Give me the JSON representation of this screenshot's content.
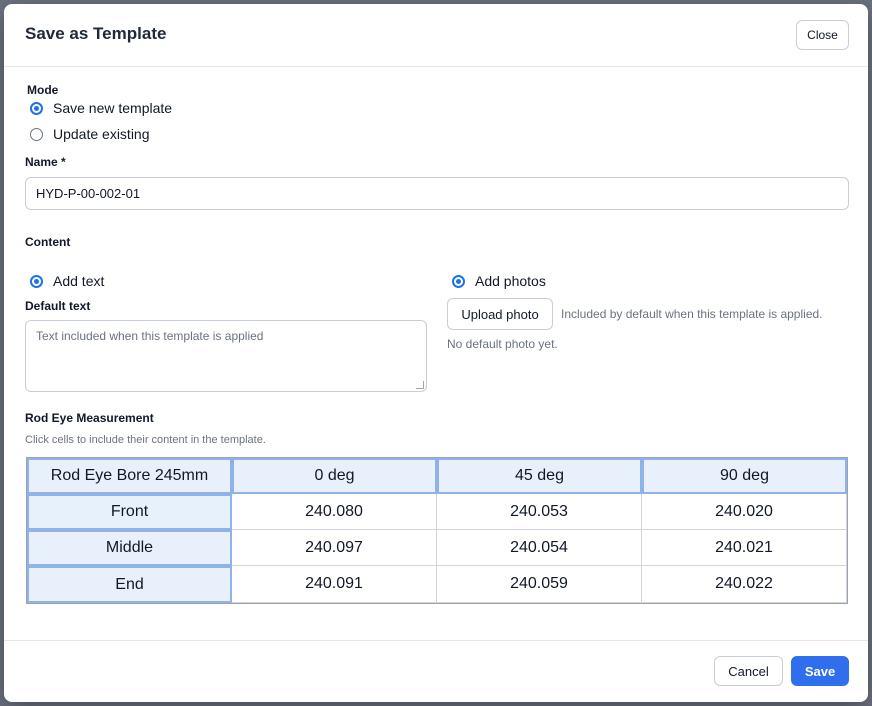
{
  "dialog": {
    "title": "Save as Template",
    "close_label": "Close"
  },
  "mode": {
    "label": "Mode",
    "options": [
      {
        "label": "Save new template",
        "selected": true
      },
      {
        "label": "Update existing",
        "selected": false
      }
    ]
  },
  "name": {
    "label": "Name *",
    "value": "HYD-P-00-002-01"
  },
  "content": {
    "label": "Content",
    "add_text_label": "Add text",
    "add_text_selected": true,
    "default_text_label": "Default text",
    "default_text_placeholder": "Text included when this template is applied",
    "add_photos_label": "Add photos",
    "add_photos_selected": true,
    "upload_label": "Upload photo",
    "upload_hint": "Included by default when this template is applied.",
    "no_photo_text": "No default photo yet."
  },
  "measurement": {
    "title": "Rod Eye Measurement",
    "hint": "Click cells to include their content in the template.",
    "header": [
      "Rod Eye Bore 245mm",
      "0 deg",
      "45 deg",
      "90 deg"
    ],
    "rows": [
      {
        "label": "Front",
        "values": [
          "240.080",
          "240.053",
          "240.020"
        ]
      },
      {
        "label": "Middle",
        "values": [
          "240.097",
          "240.054",
          "240.021"
        ]
      },
      {
        "label": "End",
        "values": [
          "240.091",
          "240.059",
          "240.022"
        ]
      }
    ]
  },
  "footer": {
    "cancel_label": "Cancel",
    "save_label": "Save"
  },
  "colors": {
    "accent": "#2f6fed",
    "radio": "#1a73e8",
    "header_cell_bg": "#e8f0fb",
    "header_cell_border": "#8fb3e6"
  }
}
